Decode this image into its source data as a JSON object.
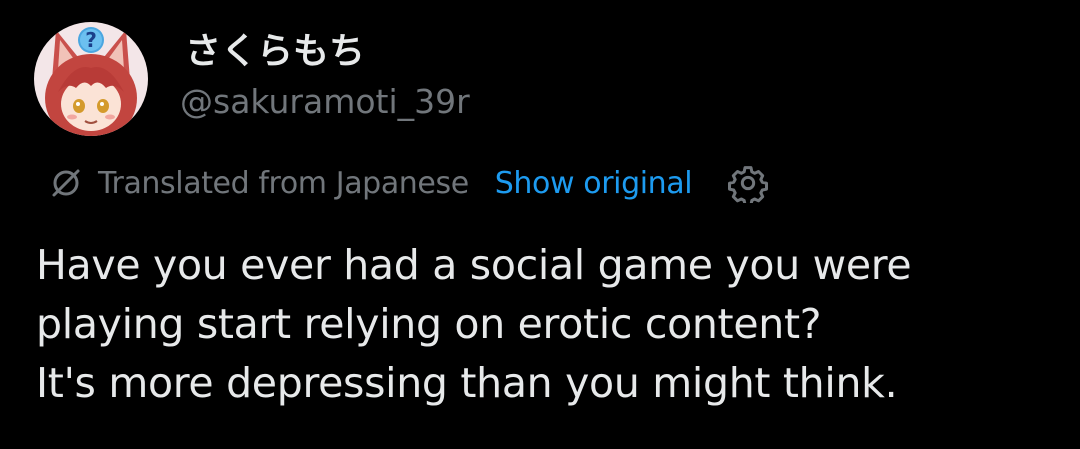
{
  "user": {
    "display_name": "さくらもち",
    "handle": "@sakuramoti_39r",
    "avatar_badge_glyph": "?"
  },
  "translation": {
    "label": "Translated from Japanese",
    "show_original_label": "Show original",
    "icon": "translate-icon",
    "settings_icon": "gear-icon"
  },
  "tweet": {
    "lines": [
      "Have you ever had a social game you were",
      "playing start relying on erotic content?",
      "It's more depressing than you might think."
    ]
  },
  "colors": {
    "background": "#000000",
    "primary_text": "#e7e9ea",
    "secondary_text": "#71767b",
    "link": "#1d9bf0"
  }
}
